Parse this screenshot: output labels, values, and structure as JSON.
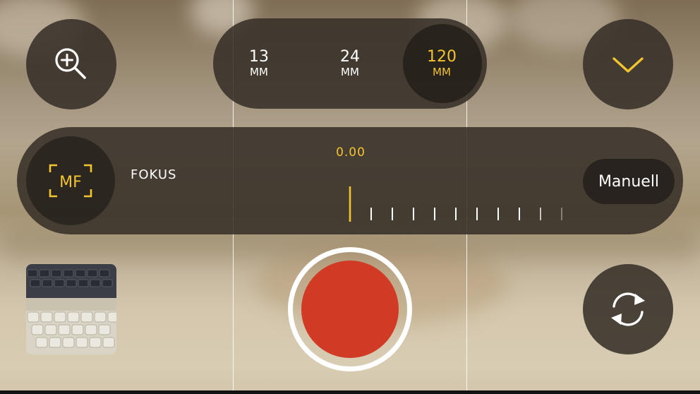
{
  "lens_selector": {
    "options": [
      {
        "value": "13",
        "unit": "MM"
      },
      {
        "value": "24",
        "unit": "MM"
      },
      {
        "value": "120",
        "unit": "MM"
      }
    ],
    "selected": "120"
  },
  "focus": {
    "label": "FOKUS",
    "value": "0.00",
    "mode_badge": "MF",
    "mode_button": "Manuell"
  },
  "icons": {
    "zoom": "zoom-in-icon",
    "collapse": "chevron-down-icon",
    "flip": "camera-flip-icon",
    "manual_focus": "mf-icon"
  },
  "colors": {
    "accent": "#f4c430",
    "record": "#d13a24",
    "control_bg": "#373028"
  }
}
